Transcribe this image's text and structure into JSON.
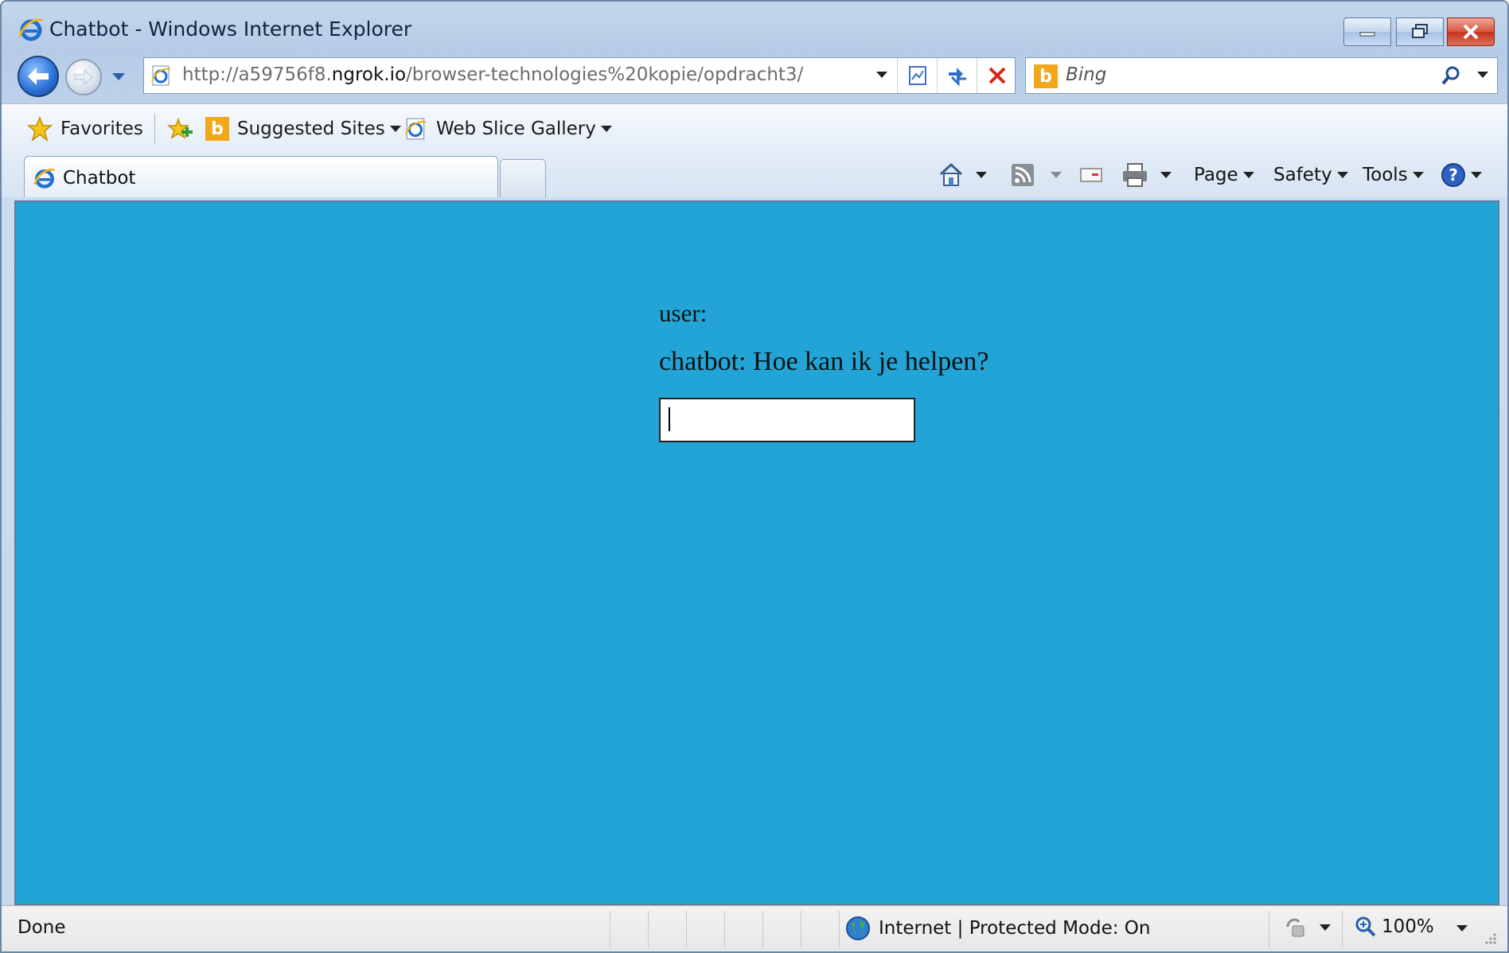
{
  "window": {
    "title": "Chatbot - Windows Internet Explorer"
  },
  "address_bar": {
    "url_prefix": "http://a59756f8.",
    "url_host": "ngrok.io",
    "url_path": "/browser-technologies%20kopie/opdracht3/"
  },
  "search": {
    "placeholder": "Bing"
  },
  "favorites_bar": {
    "favorites_label": "Favorites",
    "suggested_sites_label": "Suggested Sites",
    "web_slice_label": "Web Slice Gallery"
  },
  "tabs": [
    {
      "title": "Chatbot",
      "active": true
    }
  ],
  "command_bar": {
    "page_label": "Page",
    "safety_label": "Safety",
    "tools_label": "Tools"
  },
  "page": {
    "background_color": "#22a4d6",
    "user_line": "user:",
    "bot_line": "chatbot: Hoe kan ik je helpen?",
    "input_value": ""
  },
  "status_bar": {
    "status_text": "Done",
    "zone_text": "Internet | Protected Mode: On",
    "zoom_text": "100%"
  }
}
